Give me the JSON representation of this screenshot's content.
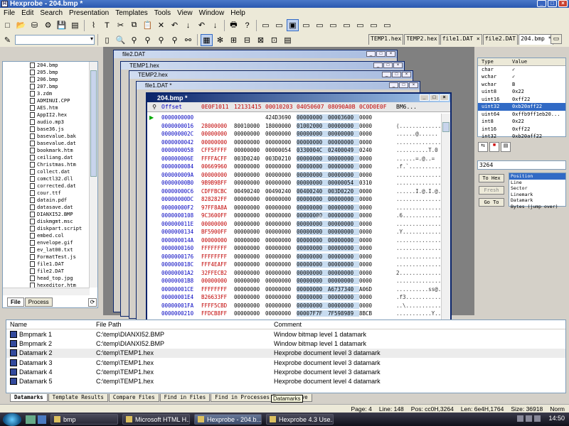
{
  "window": {
    "title": "Hexprobe - 204.bmp *"
  },
  "menu": [
    "File",
    "Edit",
    "Search",
    "Presentation",
    "Templates",
    "Tools",
    "View",
    "Window",
    "Help"
  ],
  "doc_tabs": [
    {
      "label": "TEMP1.hex",
      "active": false
    },
    {
      "label": "TEMP2.hex",
      "active": false
    },
    {
      "label": "file1.DAT ×",
      "active": false
    },
    {
      "label": "file2.DAT",
      "active": false
    },
    {
      "label": "204.bmp *",
      "active": true
    }
  ],
  "files": [
    "204.bmp",
    "205.bmp",
    "206.bmp",
    "207.bmp",
    "3.zdm",
    "ADMINUI.CPP",
    "AES.htm",
    "AppII2.hex",
    "audio.mp3",
    "base36.js",
    "basevalue.bak",
    "basevalue.dat",
    "bookmark.htm",
    "ceiliang.dat",
    "Christmas.htm",
    "collect.dat",
    "comctl32.dll",
    "corrected.dat",
    "cour.ttf",
    "datain.pdf",
    "datasave.dat",
    "DIANXI52.BMP",
    "diskmgmt.msc",
    "diskpart.script",
    "embed.col",
    "envelope.gif",
    "ev_lat00.txt",
    "FormatTest.js",
    "file1.DAT",
    "file2.DAT",
    "head_top.jpg",
    "hexeditor.htm"
  ],
  "left_tabs": [
    "File",
    "Process"
  ],
  "mdi_windows": [
    "file2.DAT",
    "TEMP1.hex",
    "TEMP2.hex",
    "file1.DAT *"
  ],
  "hex_window": {
    "title": "204.bmp *",
    "offset_header": "Offset",
    "col_headers": [
      "0E0F1011",
      "12131415",
      "00010203",
      "04050607",
      "08090A0B",
      "0C0D0E0F"
    ],
    "ascii_header": "BM6...",
    "rows": [
      {
        "off": "0000000000",
        "c": [
          "",
          "",
          "424D3690",
          "00000000",
          "00003600",
          "0000"
        ],
        "a": ""
      },
      {
        "off": "0000000016",
        "c": [
          "28000000",
          "80010000",
          "18000000",
          "01002000",
          "00000000",
          "0000"
        ],
        "a": "(............."
      },
      {
        "off": "000000002C",
        "c": [
          "00000000",
          "00000000",
          "00000000",
          "00000000",
          "00000000",
          "0000"
        ],
        "a": "......@......"
      },
      {
        "off": "0000000042",
        "c": [
          "00000000",
          "00000000",
          "00000000",
          "00000000",
          "00000000",
          "0000"
        ],
        "a": ".............."
      },
      {
        "off": "0000000058",
        "c": [
          "CFF5FFFF",
          "00000000",
          "00000054",
          "0330004C",
          "02400049",
          "0240"
        ],
        "a": "..........T.0"
      },
      {
        "off": "000000006E",
        "c": [
          "FFFFACFF",
          "003D0240",
          "003D0210",
          "00000000",
          "00000000",
          "0000"
        ],
        "a": "......=.@..="
      },
      {
        "off": "0000000084",
        "c": [
          "00669960",
          "00000000",
          "00000000",
          "00000000",
          "00000000",
          "0000"
        ],
        "a": ".f.`.........."
      },
      {
        "off": "000000009A",
        "c": [
          "00000000",
          "00000000",
          "00000000",
          "00000000",
          "00000000",
          "0000"
        ],
        "a": ".............."
      },
      {
        "off": "00000000B0",
        "c": [
          "9B9B9BFF",
          "00000000",
          "00000000",
          "00000000",
          "00000054",
          "0310"
        ],
        "a": "..............T"
      },
      {
        "off": "00000000C6",
        "c": [
          "CDFFBCBC",
          "00490240",
          "00490240",
          "00400240",
          "003D0220",
          "0000"
        ],
        "a": "......I.@.I.@."
      },
      {
        "off": "00000000DC",
        "c": [
          "828282FF",
          "00000000",
          "00000000",
          "00000000",
          "00000000",
          "0000"
        ],
        "a": ".............."
      },
      {
        "off": "00000000F2",
        "c": [
          "97FF8A8A",
          "00000000",
          "00000000",
          "00000000",
          "00000000",
          "0000"
        ],
        "a": ".............."
      },
      {
        "off": "0000000108",
        "c": [
          "9C3600FF",
          "00000000",
          "00000000",
          "00000000",
          "00000000",
          "0000"
        ],
        "a": ".6............"
      },
      {
        "off": "000000011E",
        "c": [
          "00000000",
          "00000000",
          "00000000",
          "00000000",
          "00000000",
          "0000"
        ],
        "a": ".............."
      },
      {
        "off": "0000000134",
        "c": [
          "BF5900FF",
          "00000000",
          "00000000",
          "00000000",
          "00000000",
          "0000"
        ],
        "a": ".Y............"
      },
      {
        "off": "000000014A",
        "c": [
          "00000000",
          "00000000",
          "00000000",
          "00000000",
          "00000000",
          "0000"
        ],
        "a": ".............."
      },
      {
        "off": "0000000160",
        "c": [
          "FFFFFFFF",
          "00000000",
          "00000000",
          "00000000",
          "00000000",
          "0000"
        ],
        "a": ".............."
      },
      {
        "off": "0000000176",
        "c": [
          "FFFFFFFF",
          "00000000",
          "00000000",
          "00000000",
          "00000000",
          "0000"
        ],
        "a": ".............."
      },
      {
        "off": "000000018C",
        "c": [
          "FFF4EAFF",
          "00000000",
          "00000000",
          "00000000",
          "00000000",
          "0000"
        ],
        "a": ".............."
      },
      {
        "off": "00000001A2",
        "c": [
          "32FFECB2",
          "00000000",
          "00000000",
          "00000000",
          "00000000",
          "0000"
        ],
        "a": "2............."
      },
      {
        "off": "00000001B8",
        "c": [
          "00000000",
          "00000000",
          "00000000",
          "00000000",
          "00000000",
          "0000"
        ],
        "a": ".............."
      },
      {
        "off": "00000001CE",
        "c": [
          "FFFFFFFF",
          "00000000",
          "00000000",
          "00000000",
          "A6737340",
          "A06D"
        ],
        "a": "..........ss@.m"
      },
      {
        "off": "00000001E4",
        "c": [
          "B26633FF",
          "00000000",
          "00000000",
          "00000000",
          "00000000",
          "0000"
        ],
        "a": ".f3..........."
      },
      {
        "off": "00000001FA",
        "c": [
          "FFFF5CBD",
          "00000000",
          "00000000",
          "00000000",
          "00000000",
          "0000"
        ],
        "a": "..\\..........."
      },
      {
        "off": "0000000210",
        "c": [
          "FFDCB8FF",
          "00000000",
          "00000000",
          "00007F7F",
          "7F598989",
          "8BCB"
        ],
        "a": "...........Y.."
      }
    ]
  },
  "type_panel": {
    "headers": [
      "Type",
      "Value"
    ],
    "rows": [
      {
        "t": "char",
        "v": "✓",
        "sel": false
      },
      {
        "t": "wchar",
        "v": "✓",
        "sel": false
      },
      {
        "t": "wchar",
        "v": "B",
        "sel": false
      },
      {
        "t": "uint8",
        "v": "0x22",
        "sel": false
      },
      {
        "t": "uint16",
        "v": "0xff22",
        "sel": false
      },
      {
        "t": "uint32",
        "v": "0xb20aff22",
        "sel": true
      },
      {
        "t": "uint64",
        "v": "0xffb9ff1eb20...",
        "sel": false
      },
      {
        "t": "int8",
        "v": "0x22",
        "sel": false
      },
      {
        "t": "int16",
        "v": "0xff22",
        "sel": false
      },
      {
        "t": "int32",
        "v": "0xb20aff22",
        "sel": false
      }
    ]
  },
  "goto": {
    "input_value": "3264",
    "to_hex": "To Hex",
    "fresh": "Fresh",
    "go_to": "Go To",
    "modes": [
      {
        "label": "Position",
        "sel": true
      },
      {
        "label": "Line",
        "sel": false
      },
      {
        "label": "Sector",
        "sel": false
      },
      {
        "label": "Linemark",
        "sel": false
      },
      {
        "label": "Datamark",
        "sel": false
      },
      {
        "label": "Bytes (jump over)",
        "sel": false
      }
    ]
  },
  "datamarks": {
    "headers": [
      "Name",
      "File Path",
      "Comment"
    ],
    "rows": [
      {
        "name": "Bmpmark 1",
        "path": "C:\\temp\\DIANXI52.BMP",
        "comment": "Window bitmap level 1 datamark"
      },
      {
        "name": "Bmpmark 2",
        "path": "C:\\temp\\DIANXI52.BMP",
        "comment": "Window bitmap level 1 datamark"
      },
      {
        "name": "Datamark 2",
        "path": "C:\\temp\\TEMP1.hex",
        "comment": "Hexprobe document level 3 datamark"
      },
      {
        "name": "Datamark 3",
        "path": "C:\\temp\\TEMP1.hex",
        "comment": "Hexprobe document level 3 datamark"
      },
      {
        "name": "Datamark 4",
        "path": "C:\\temp\\TEMP1.hex",
        "comment": "Hexprobe document level 3 datamark"
      },
      {
        "name": "Datamark 5",
        "path": "C:\\temp\\TEMP1.hex",
        "comment": "Hexprobe document level 4 datamark"
      }
    ],
    "tabs": [
      "Datamarks",
      "Template Results",
      "Compare Files",
      "Find in Files",
      "Find in Processes",
      "isk/Drive"
    ],
    "tooltip": "Datamarks"
  },
  "status": {
    "page": "Page: 4",
    "line": "Line: 148",
    "pos": "Pos: cc0H,3264",
    "len": "Len: 6e4H,1764",
    "size": "Size: 36918",
    "mode": "Norm"
  },
  "taskbar": {
    "tasks": [
      {
        "label": "bmp",
        "active": false
      },
      {
        "label": "Microsoft HTML H...",
        "active": false
      },
      {
        "label": "Hexprobe - 204.b...",
        "active": true
      },
      {
        "label": "Hexprobe 4.3 Use...",
        "active": false
      }
    ],
    "clock": "14:50"
  }
}
